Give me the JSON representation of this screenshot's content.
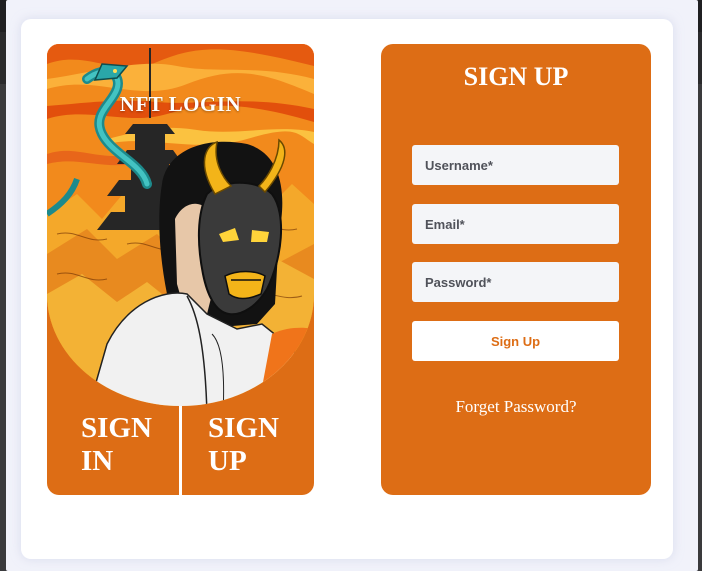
{
  "art": {
    "title": "NFT LOGIN",
    "signin_tab": "SIGN IN",
    "signup_tab": "SIGN UP",
    "illustration": "oni-mask-samurai-dragon-pagoda"
  },
  "form": {
    "title": "SIGN UP",
    "username_placeholder": "Username*",
    "email_placeholder": "Email*",
    "password_placeholder": "Password*",
    "submit_label": "Sign Up",
    "forget_link": "Forget Password?"
  },
  "colors": {
    "accent": "#dd6d15",
    "field_bg": "#f4f5f8",
    "modal_bg": "#f1f2fa"
  }
}
